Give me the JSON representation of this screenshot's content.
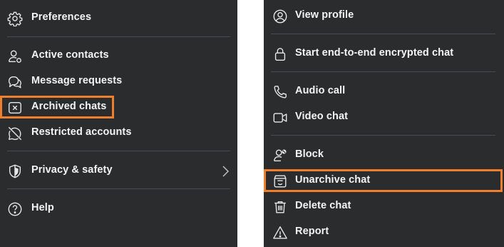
{
  "left_menu": {
    "items": [
      {
        "label": "Preferences",
        "icon": "gear-icon"
      },
      {
        "label": "Active contacts",
        "icon": "person-status-icon"
      },
      {
        "label": "Message requests",
        "icon": "chat-bubbles-icon"
      },
      {
        "label": "Archived chats",
        "icon": "archive-box-x-icon"
      },
      {
        "label": "Restricted accounts",
        "icon": "chat-slash-icon"
      },
      {
        "label": "Privacy & safety",
        "icon": "shield-icon"
      },
      {
        "label": "Help",
        "icon": "question-circle-icon"
      }
    ],
    "highlighted_item": "Archived chats"
  },
  "right_menu": {
    "items": [
      {
        "label": "View profile",
        "icon": "person-circle-icon"
      },
      {
        "label": "Start end-to-end encrypted chat",
        "icon": "lock-icon"
      },
      {
        "label": "Audio call",
        "icon": "phone-icon"
      },
      {
        "label": "Video chat",
        "icon": "video-camera-icon"
      },
      {
        "label": "Block",
        "icon": "person-block-icon"
      },
      {
        "label": "Unarchive chat",
        "icon": "unarchive-box-icon"
      },
      {
        "label": "Delete chat",
        "icon": "trash-icon"
      },
      {
        "label": "Report",
        "icon": "warning-triangle-icon"
      }
    ],
    "highlighted_item": "Unarchive chat"
  },
  "colors": {
    "panel_background": "#2b2c2e",
    "text": "#f4f4f4",
    "divider": "#4a4b4e",
    "highlight": "#f07f2d"
  }
}
